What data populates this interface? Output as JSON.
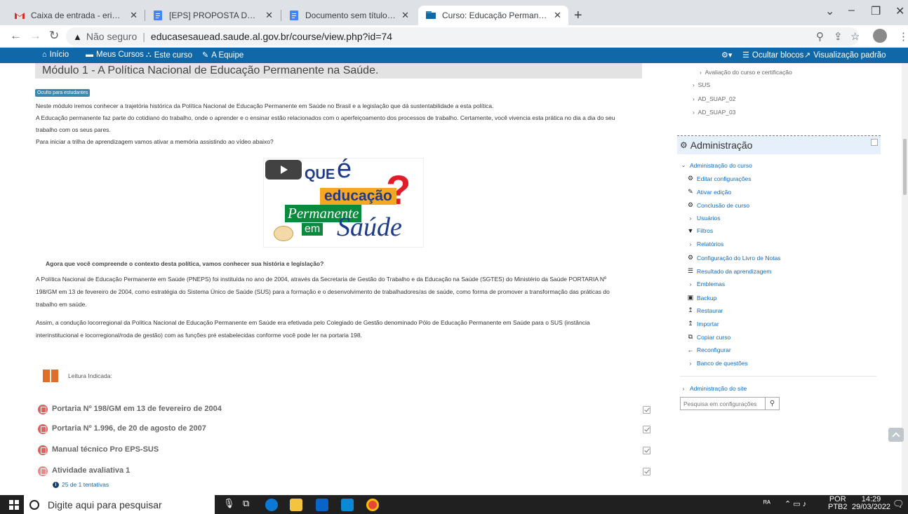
{
  "browser": {
    "tabs": [
      {
        "title": "Caixa de entrada - erivaldolimah",
        "favicon": "gmail-icon",
        "color": "#d93025"
      },
      {
        "title": "[EPS] PROPOSTA DE READEQUAÇ",
        "favicon": "docs-icon",
        "color": "#4285f4"
      },
      {
        "title": "Documento sem título - Docume",
        "favicon": "docs-icon",
        "color": "#4285f4"
      },
      {
        "title": "Curso: Educação Permanente em",
        "favicon": "moodle-icon",
        "color": "#1168a8"
      }
    ],
    "url_warning": "Não seguro",
    "url": "educasesauead.saude.al.gov.br/course/view.php?id=74"
  },
  "topnav": {
    "home": "Início",
    "my_courses": "Meus Cursos",
    "this_course": "Este curso",
    "team": "A Equipe",
    "hide_blocks": "Ocultar blocos",
    "standard_view": "Visualização padrão"
  },
  "section": {
    "title": "Módulo 1 - A Política Nacional de Educação Permanente na Saúde.",
    "hidden_badge": "Oculto para estudantes",
    "intro_lines": [
      "Neste módulo iremos conhecer a trajetória histórica da Política Nacional de Educação Permanente em Saúde no Brasil e a legislação que dá sustentabilidade a esta política.",
      "A Educação permanente faz parte do cotidiano do trabalho, onde o aprender e o ensinar estão relacionados com o aperfeiçoamento dos processos de trabalho. Certamente, você vivencia esta prática no dia a dia do seu",
      "trabalho com os seus pares.",
      "Para iniciar a trilha de aprendizagem vamos ativar a memória assistindo ao vídeo abaixo?"
    ],
    "video": {
      "line_que": "QUE",
      "line_e": "é",
      "line_educacao": "educação",
      "line_permanente": "Permanente",
      "line_em": "em",
      "line_saude": "Saúde",
      "qmark": "?"
    },
    "question": "Agora que você compreende o contexto desta política, vamos conhecer sua história e legislação?",
    "para1_lines": [
      "A Política Nacional de Educação Permanente em Saúde (PNEPS) foi instituída no ano de 2004, através da Secretaria de Gestão do Trabalho e da Educação na Saúde (SGTES) do Ministério da Saúde PORTARIA Nº",
      "198/GM em 13 de fevereiro de 2004, como estratégia do Sistema Único de Saúde (SUS) para a formação e o desenvolvimento de trabalhadores/as de saúde, como forma de promover a transformação das práticas do",
      "trabalho em saúde."
    ],
    "para2_lines": [
      "Assim, a condução locorregional da Política Nacional de Educação Permanente em Saúde era efetivada pelo Colegiado de Gestão denominado Pólo de Educação Permanente em Saúde para o SUS (instância",
      "interinstitucional e locorregional/roda de gestão) com as funções pré estabelecidas conforme você pode ler na portaria 198."
    ],
    "reading_label": "Leitura Indicada:",
    "resources": [
      {
        "label": "Portaria Nº 198/GM em 13 de fevereiro de 2004"
      },
      {
        "label": "Portaria Nº 1.996, de 20 de agosto de 2007"
      },
      {
        "label": "Manual técnico Pro EPS-SUS"
      },
      {
        "label": "Atividade avaliativa 1"
      }
    ],
    "attempts": "25 de 1 tentativas"
  },
  "sidebar": {
    "tree": [
      "Avaliação do curso e certificação",
      "SUS",
      "AD_SUAP_02",
      "AD_SUAP_03"
    ],
    "admin_title": "Administração",
    "course_admin": "Administração do curso",
    "admin_items": [
      {
        "label": "Editar configurações",
        "icon": "gear-icon"
      },
      {
        "label": "Ativar edição",
        "icon": "pencil-icon"
      },
      {
        "label": "Conclusão de curso",
        "icon": "gear-icon"
      },
      {
        "label": "Usuários",
        "icon": "chevron-right-icon"
      },
      {
        "label": "Filtros",
        "icon": "filter-icon"
      },
      {
        "label": "Relatórios",
        "icon": "chevron-right-icon"
      },
      {
        "label": "Configuração do Livro de Notas",
        "icon": "gear-icon"
      },
      {
        "label": "Resultado da aprendizagem",
        "icon": "list-icon"
      },
      {
        "label": "Emblemas",
        "icon": "chevron-right-icon"
      },
      {
        "label": "Backup",
        "icon": "backup-icon"
      },
      {
        "label": "Restaurar",
        "icon": "upload-icon"
      },
      {
        "label": "Importar",
        "icon": "upload-icon"
      },
      {
        "label": "Copiar curso",
        "icon": "copy-icon"
      },
      {
        "label": "Reconfigurar",
        "icon": "arrow-left-icon"
      },
      {
        "label": "Banco de questões",
        "icon": "chevron-right-icon"
      }
    ],
    "site_admin": "Administração do site",
    "search_placeholder": "Pesquisa em configurações"
  },
  "taskbar": {
    "search_placeholder": "Digite aqui para pesquisar",
    "lang": "POR",
    "layout": "PTB2",
    "time": "14:29",
    "date": "29/03/2022"
  }
}
